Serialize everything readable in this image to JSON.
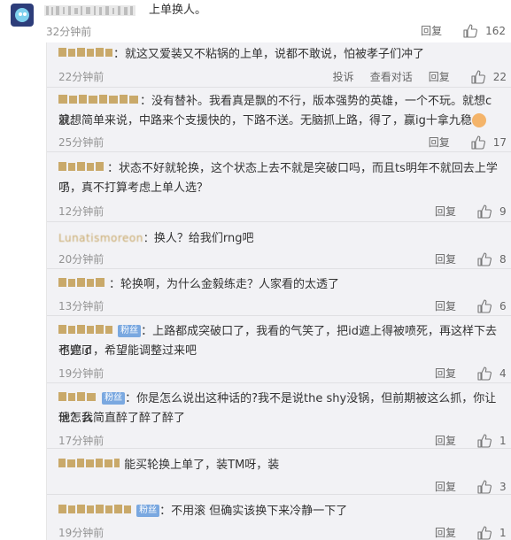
{
  "main_comment": {
    "text": "上单换人。",
    "time": "32分钟前",
    "reply_label": "回复",
    "likes": "162"
  },
  "replies": [
    {
      "text": "就这又爱装又不粘锅的上单，说都不敢说，怕被孝子们冲了",
      "time": "22分钟前",
      "actions": [
        "投诉",
        "查看对话",
        "回复"
      ],
      "likes": "22"
    },
    {
      "text_line1": "没有替补。我看真是飘的不行，版本强势的英雄，一个不玩。就想c就想",
      "text_line2": "浪。简单来说，中路来个支援快的，下路不送。无脑抓上路，得了，赢ig十拿九稳",
      "time": "25分钟前",
      "reply_label": "回复",
      "likes": "17"
    },
    {
      "text_line1": "状态不好就轮换，这个状态上去不就是突破口吗，而且ts明年不就回去上学了",
      "text_line2": "吗，真不打算考虑上单人选？",
      "time": "12分钟前",
      "reply_label": "回复",
      "likes": "9"
    },
    {
      "name": "Lunatismoreon",
      "text": "换人？给我们rng吧",
      "time": "20分钟前",
      "reply_label": "回复",
      "likes": "8"
    },
    {
      "text": "轮换啊，为什么金毅练走？人家看的太透了",
      "time": "13分钟前",
      "reply_label": "回复",
      "likes": "6"
    },
    {
      "badge": "粉丝",
      "text_line1": "上路都成突破口了，我看的气笑了，把id遮上得被喷死，再这样下去不遮id",
      "text_line2": "也完了，希望能调整过来吧",
      "time": "19分钟前",
      "reply_label": "回复",
      "likes": "4"
    },
    {
      "badge": "粉丝",
      "text_line1": "你是怎么说出这种话的?我不是说the shy没锅，但前期被这么抓，你让他怎么",
      "text_line2": "玩？我简直醉了醉了醉了",
      "time": "17分钟前",
      "reply_label": "回复",
      "likes": "1"
    },
    {
      "text": "能买轮换上单了，装TM呀，装",
      "time": "",
      "reply_label": "回复",
      "likes": "3"
    },
    {
      "badge": "粉丝",
      "text": "不用滚 但确实该换下来冷静一下了",
      "time": "19分钟前",
      "reply_label": "回复",
      "likes": "1"
    }
  ],
  "colors": {
    "reply_bg": "#f2f2f5",
    "meta_gray": "#939393",
    "badge_blue": "#7aa8e0",
    "blur_name": "#c9a96a"
  },
  "icons": [
    "avatar-icon",
    "thumb-up-icon",
    "emoji-icon"
  ]
}
